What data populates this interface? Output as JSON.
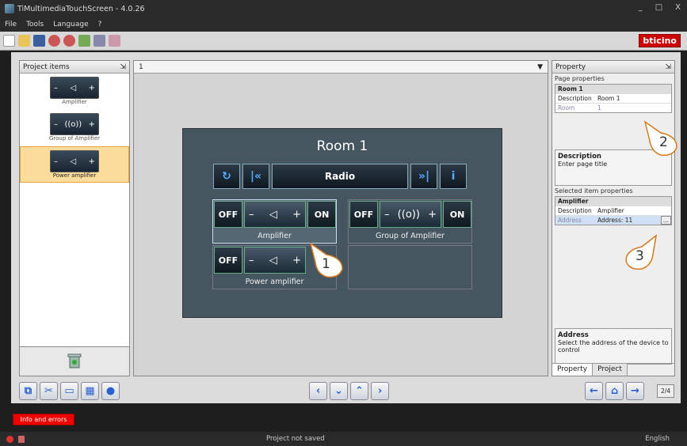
{
  "window": {
    "title": "TiMultimediaTouchScreen - 4.0.26",
    "min": "_",
    "max": "□",
    "close": "X"
  },
  "menu": [
    "File",
    "Tools",
    "Language",
    "?"
  ],
  "brand": "bticino",
  "left_panel": {
    "title": "Project items",
    "items": [
      {
        "label": "Amplifier"
      },
      {
        "label": "Group of Amplifier"
      },
      {
        "label": "Power amplifier"
      }
    ]
  },
  "center": {
    "page_selector": "1",
    "page": {
      "title": "Room 1",
      "source": "Radio",
      "cells": [
        {
          "label": "Amplifier",
          "off": "OFF",
          "on": "ON"
        },
        {
          "label": "Group of Amplifier",
          "off": "OFF",
          "on": "ON"
        },
        {
          "label": "Power amplifier",
          "off": "OFF"
        }
      ]
    }
  },
  "right_panel": {
    "title": "Property",
    "page_properties_label": "Page properties",
    "page_group": "Room 1",
    "page_rows": [
      {
        "k": "Description",
        "v": "Room 1"
      },
      {
        "k": "Room",
        "v": "1"
      }
    ],
    "desc_title": "Description",
    "desc_text": "Enter page title",
    "selected_label": "Selected item properties",
    "item_group": "Amplifier",
    "item_rows": [
      {
        "k": "Description",
        "v": "Amplifier"
      },
      {
        "k": "Address",
        "v": "Address: 11"
      }
    ],
    "browse": "...",
    "addr_title": "Address",
    "addr_text": "Select the address of the device to control",
    "tabs": [
      "Property",
      "Project"
    ]
  },
  "page_counter": "2/4",
  "info_button": "Info and errors",
  "status": "Project not saved",
  "language": "English",
  "callouts": [
    "1",
    "2",
    "3"
  ]
}
